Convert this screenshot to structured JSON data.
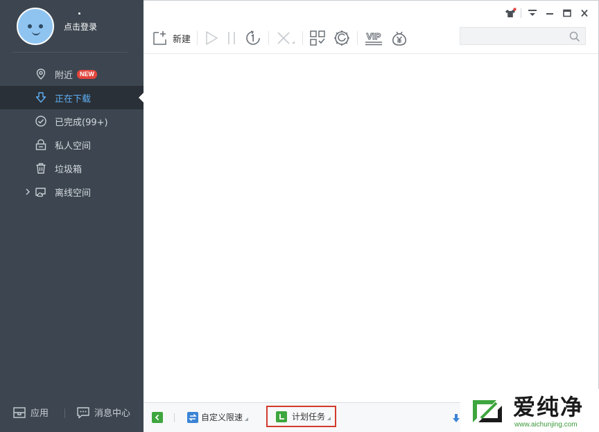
{
  "user": {
    "login_label": "点击登录"
  },
  "sidebar": {
    "items": [
      {
        "label": "附近",
        "badge": "NEW",
        "icon": "location-pin-icon"
      },
      {
        "label": "正在下载",
        "icon": "download-arrow-icon",
        "active": true
      },
      {
        "label": "已完成(99+)",
        "icon": "check-circle-icon"
      },
      {
        "label": "私人空间",
        "icon": "lock-icon"
      },
      {
        "label": "垃圾箱",
        "icon": "trash-icon"
      },
      {
        "label": "离线空间",
        "icon": "cloud-folder-icon"
      }
    ],
    "bottom": {
      "apps_label": "应用",
      "messages_label": "消息中心"
    }
  },
  "toolbar": {
    "new_label": "新建",
    "vip_label": "VIP"
  },
  "statusbar": {
    "speed_label": "自定义限速",
    "plan_label": "计划任务"
  },
  "watermark": {
    "title": "爱纯净",
    "url": "www.aichunjing.com"
  },
  "colors": {
    "sidebar_bg": "#3d4650",
    "active_bg": "#2a3037",
    "accent_blue": "#5fb0f5",
    "badge_red": "#e2453c",
    "highlight_red": "#d23a2c",
    "green": "#3ea63e"
  }
}
